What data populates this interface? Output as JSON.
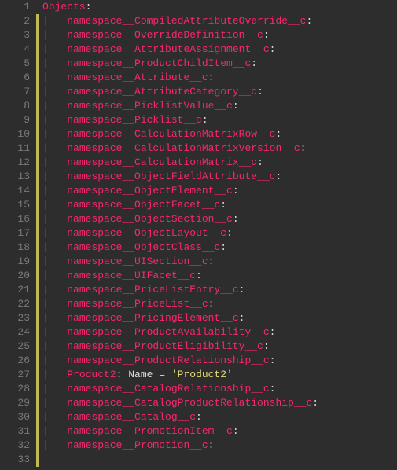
{
  "file": {
    "topKey": "Objects",
    "lines": [
      {
        "num": 1,
        "type": "top",
        "key": "Objects"
      },
      {
        "num": 2,
        "type": "ns",
        "key": "namespace__CompiledAttributeOverride__c"
      },
      {
        "num": 3,
        "type": "ns",
        "key": "namespace__OverrideDefinition__c"
      },
      {
        "num": 4,
        "type": "ns",
        "key": "namespace__AttributeAssignment__c"
      },
      {
        "num": 5,
        "type": "ns",
        "key": "namespace__ProductChildItem__c"
      },
      {
        "num": 6,
        "type": "ns",
        "key": "namespace__Attribute__c"
      },
      {
        "num": 7,
        "type": "ns",
        "key": "namespace__AttributeCategory__c"
      },
      {
        "num": 8,
        "type": "ns",
        "key": "namespace__PicklistValue__c"
      },
      {
        "num": 9,
        "type": "ns",
        "key": "namespace__Picklist__c"
      },
      {
        "num": 10,
        "type": "ns",
        "key": "namespace__CalculationMatrixRow__c"
      },
      {
        "num": 11,
        "type": "ns",
        "key": "namespace__CalculationMatrixVersion__c"
      },
      {
        "num": 12,
        "type": "ns",
        "key": "namespace__CalculationMatrix__c"
      },
      {
        "num": 13,
        "type": "ns",
        "key": "namespace__ObjectFieldAttribute__c"
      },
      {
        "num": 14,
        "type": "ns",
        "key": "namespace__ObjectElement__c"
      },
      {
        "num": 15,
        "type": "ns",
        "key": "namespace__ObjectFacet__c"
      },
      {
        "num": 16,
        "type": "ns",
        "key": "namespace__ObjectSection__c"
      },
      {
        "num": 17,
        "type": "ns",
        "key": "namespace__ObjectLayout__c"
      },
      {
        "num": 18,
        "type": "ns",
        "key": "namespace__ObjectClass__c"
      },
      {
        "num": 19,
        "type": "ns",
        "key": "namespace__UISection__c"
      },
      {
        "num": 20,
        "type": "ns",
        "key": "namespace__UIFacet__c"
      },
      {
        "num": 21,
        "type": "ns",
        "key": "namespace__PriceListEntry__c"
      },
      {
        "num": 22,
        "type": "ns",
        "key": "namespace__PriceList__c"
      },
      {
        "num": 23,
        "type": "ns",
        "key": "namespace__PricingElement__c"
      },
      {
        "num": 24,
        "type": "ns",
        "key": "namespace__ProductAvailability__c"
      },
      {
        "num": 25,
        "type": "ns",
        "key": "namespace__ProductEligibility__c"
      },
      {
        "num": 26,
        "type": "ns",
        "key": "namespace__ProductRelationship__c"
      },
      {
        "num": 27,
        "type": "kv",
        "key": "Product2",
        "rhsLabel": " Name = ",
        "rhsValue": "'Product2'"
      },
      {
        "num": 28,
        "type": "ns",
        "key": "namespace__CatalogRelationship__c"
      },
      {
        "num": 29,
        "type": "ns",
        "key": "namespace__CatalogProductRelationship__c"
      },
      {
        "num": 30,
        "type": "ns",
        "key": "namespace__Catalog__c"
      },
      {
        "num": 31,
        "type": "ns",
        "key": "namespace__PromotionItem__c"
      },
      {
        "num": 32,
        "type": "ns",
        "key": "namespace__Promotion__c"
      },
      {
        "num": 33,
        "type": "blank"
      }
    ],
    "indentGuide": "| ",
    "indentSpace": "  "
  }
}
